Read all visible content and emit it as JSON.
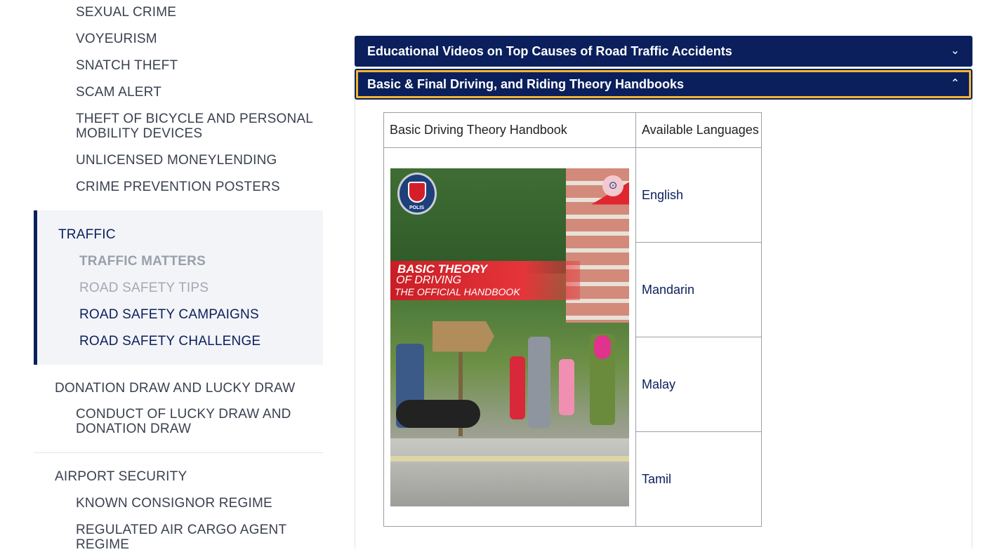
{
  "sidebar": {
    "crime_items": [
      "SEXUAL CRIME",
      "VOYEURISM",
      "SNATCH THEFT",
      "SCAM ALERT",
      "THEFT OF BICYCLE AND PERSONAL",
      "MOBILITY DEVICES",
      "UNLICENSED MONEYLENDING",
      "CRIME PREVENTION POSTERS"
    ],
    "traffic": {
      "heading": "TRAFFIC",
      "items": [
        "TRAFFIC MATTERS",
        "ROAD SAFETY TIPS",
        "ROAD SAFETY CAMPAIGNS",
        "ROAD SAFETY CHALLENGE"
      ]
    },
    "donation": {
      "heading": "DONATION DRAW AND LUCKY DRAW",
      "item_line1": "CONDUCT OF LUCKY DRAW AND",
      "item_line2": "DONATION DRAW"
    },
    "airport": {
      "heading": "AIRPORT SECURITY",
      "items": [
        "KNOWN CONSIGNOR REGIME",
        "REGULATED AIR CARGO AGENT",
        "REGIME"
      ]
    }
  },
  "accordions": [
    {
      "title": "Educational Videos on Top Causes of Road Traffic Accidents",
      "icon": "chevron-down-icon",
      "chevron": "⌄"
    },
    {
      "title": "Basic & Final Driving, and Riding Theory Handbooks",
      "icon": "chevron-up-icon",
      "chevron": "⌃"
    }
  ],
  "handbook_table": {
    "col1_header": "Basic Driving Theory Handbook",
    "col2_header": "Available Languages",
    "languages": [
      "English",
      "Mandarin",
      "Malay",
      "Tamil"
    ],
    "cover": {
      "line1": "BASIC THEORY",
      "line2": "OF DRIVING",
      "line3": "THE OFFICIAL HANDBOOK",
      "crest_text": "POLIS"
    }
  },
  "colors": {
    "navy": "#0a1f5c",
    "focus": "#f2b631",
    "cover_red": "#e5353a"
  }
}
